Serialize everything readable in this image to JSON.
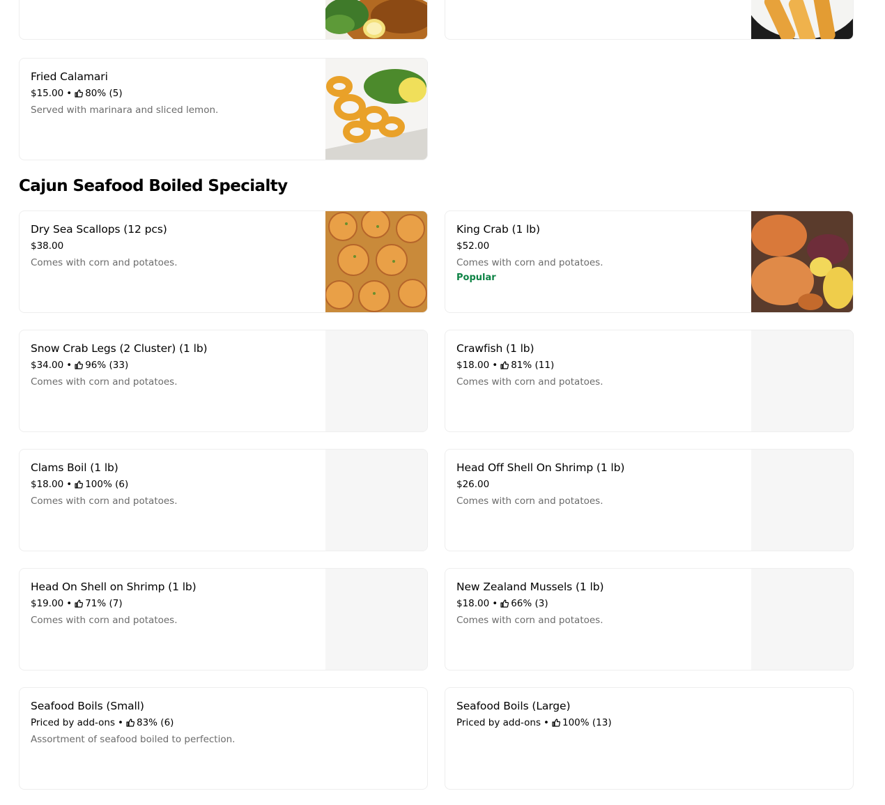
{
  "top_items": [
    {
      "name": "Fried Calamari",
      "price": "$15.00",
      "rating": "80% (5)",
      "desc": "Served with marinara and sliced lemon."
    }
  ],
  "section": {
    "title": "Cajun Seafood Boiled Specialty"
  },
  "items": [
    {
      "name": "Dry Sea Scallops (12 pcs)",
      "price": "$38.00",
      "rating": "",
      "desc": "Comes with corn and potatoes.",
      "badge": ""
    },
    {
      "name": "King Crab (1 lb)",
      "price": "$52.00",
      "rating": "",
      "desc": "Comes with corn and potatoes.",
      "badge": "Popular"
    },
    {
      "name": "Snow Crab Legs (2 Cluster) (1 lb)",
      "price": "$34.00",
      "rating": "96% (33)",
      "desc": "Comes with corn and potatoes.",
      "badge": ""
    },
    {
      "name": "Crawfish (1 lb)",
      "price": "$18.00",
      "rating": "81% (11)",
      "desc": "Comes with corn and potatoes.",
      "badge": ""
    },
    {
      "name": "Clams Boil (1 lb)",
      "price": "$18.00",
      "rating": "100% (6)",
      "desc": "Comes with corn and potatoes.",
      "badge": ""
    },
    {
      "name": "Head Off Shell On Shrimp (1 lb)",
      "price": "$26.00",
      "rating": "",
      "desc": "Comes with corn and potatoes.",
      "badge": ""
    },
    {
      "name": "Head On Shell on Shrimp (1 lb)",
      "price": "$19.00",
      "rating": "71% (7)",
      "desc": "Comes with corn and potatoes.",
      "badge": ""
    },
    {
      "name": "New Zealand Mussels (1 lb)",
      "price": "$18.00",
      "rating": "66% (3)",
      "desc": "Comes with corn and potatoes.",
      "badge": ""
    },
    {
      "name": "Seafood Boils (Small)",
      "price": "Priced by add-ons",
      "rating": "83% (6)",
      "desc": "Assortment of seafood boiled to perfection.",
      "badge": ""
    },
    {
      "name": "Seafood Boils (Large)",
      "price": "Priced by add-ons",
      "rating": "100% (13)",
      "desc": "",
      "badge": ""
    }
  ],
  "colors": {
    "badge": "#0e8345",
    "desc": "#6b6b6b",
    "placeholder": "#f6f6f6"
  },
  "icons": {
    "rating": "thumbs-up-icon"
  }
}
